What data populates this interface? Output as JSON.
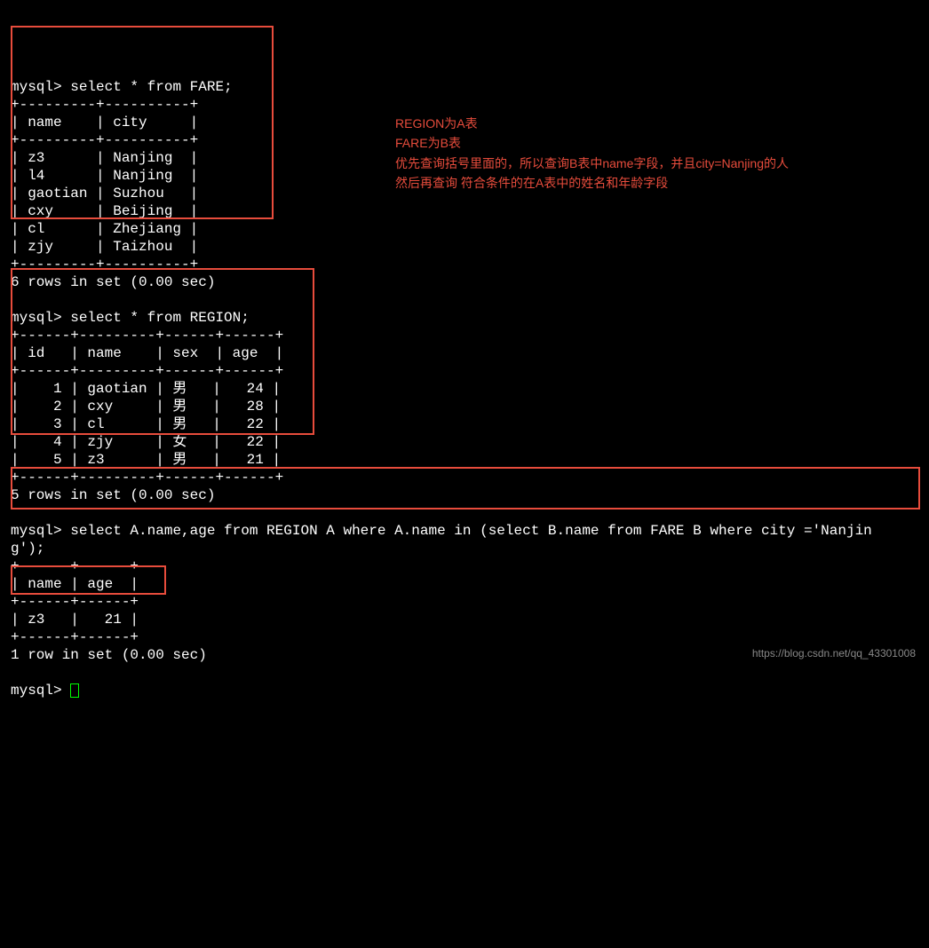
{
  "queries": {
    "q1_prompt": "mysql> ",
    "q1": "select * from FARE;",
    "q2_prompt": "mysql> ",
    "q2": "select * from REGION;",
    "q3_prompt": "mysql> ",
    "q3_line1": "select A.name,age from REGION A where A.name in (select B.name from FARE B where city ='Nanjin",
    "q3_line2": "g');",
    "q4_prompt": "mysql> "
  },
  "fare_table": {
    "border_top": "+---------+----------+",
    "header": "| name    | city     |",
    "border_mid": "+---------+----------+",
    "rows": [
      "| z3      | Nanjing  |",
      "| l4      | Nanjing  |",
      "| gaotian | Suzhou   |",
      "| cxy     | Beijing  |",
      "| cl      | Zhejiang |",
      "| zjy     | Taizhou  |"
    ],
    "border_bot": "+---------+----------+",
    "status": "6 rows in set (0.00 sec)"
  },
  "region_table": {
    "border_top": "+------+---------+------+------+",
    "header": "| id   | name    | sex  | age  |",
    "border_mid": "+------+---------+------+------+",
    "rows": [
      "|    1 | gaotian | 男   |   24 |",
      "|    2 | cxy     | 男   |   28 |",
      "|    3 | cl      | 男   |   22 |",
      "|    4 | zjy     | 女   |   22 |",
      "|    5 | z3      | 男   |   21 |"
    ],
    "border_bot": "+------+---------+------+------+",
    "status": "5 rows in set (0.00 sec)"
  },
  "result_table": {
    "border_top": "+------+------+",
    "header": "| name | age  |",
    "border_mid": "+------+------+",
    "rows": [
      "| z3   |   21 |"
    ],
    "border_bot": "+------+------+",
    "status": "1 row in set (0.00 sec)"
  },
  "annotation": {
    "line1": "REGION为A表",
    "line2": "FARE为B表",
    "line3": "优先查询括号里面的，所以查询B表中name字段，并且city=Nanjing的人",
    "line4": "然后再查询 符合条件的在A表中的姓名和年龄字段"
  },
  "watermark": "https://blog.csdn.net/qq_43301008"
}
